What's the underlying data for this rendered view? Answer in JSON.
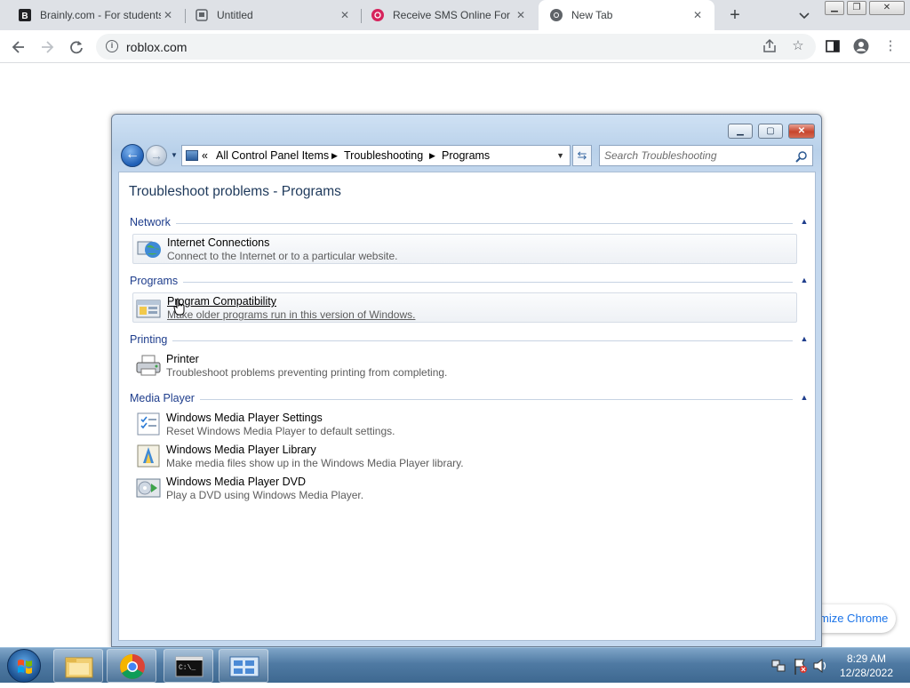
{
  "browser": {
    "tabs": [
      {
        "title": "Brainly.com - For students",
        "favicon": "brainly-icon",
        "active": false
      },
      {
        "title": "Untitled",
        "favicon": "document-icon",
        "active": false
      },
      {
        "title": "Receive SMS Online For",
        "favicon": "sms-icon",
        "active": false
      },
      {
        "title": "New Tab",
        "favicon": "chrome-icon",
        "active": true
      }
    ],
    "url": "roblox.com",
    "customize_chip": "mize Chrome"
  },
  "control_panel": {
    "breadcrumb": [
      "All Control Panel Items",
      "Troubleshooting",
      "Programs"
    ],
    "breadcrumb_overflow": "«",
    "search_placeholder": "Search Troubleshooting",
    "page_title": "Troubleshoot problems - Programs",
    "groups": [
      {
        "name": "Network",
        "items": [
          {
            "title": "Internet Connections",
            "desc": "Connect to the Internet or to a particular website.",
            "icon": "internet-connections-icon"
          }
        ]
      },
      {
        "name": "Programs",
        "items": [
          {
            "title": "Program Compatibility",
            "desc": "Make older programs run in this version of Windows.",
            "icon": "program-compatibility-icon"
          }
        ]
      },
      {
        "name": "Printing",
        "items": [
          {
            "title": "Printer",
            "desc": "Troubleshoot problems preventing printing from completing.",
            "icon": "printer-icon"
          }
        ]
      },
      {
        "name": "Media Player",
        "items": [
          {
            "title": "Windows Media Player Settings",
            "desc": "Reset Windows Media Player to default settings.",
            "icon": "wmp-settings-icon"
          },
          {
            "title": "Windows Media Player Library",
            "desc": "Make media files show up in the Windows Media Player library.",
            "icon": "wmp-library-icon"
          },
          {
            "title": "Windows Media Player DVD",
            "desc": "Play a DVD using Windows Media Player.",
            "icon": "wmp-dvd-icon"
          }
        ]
      }
    ]
  },
  "taskbar": {
    "time": "8:29 AM",
    "date": "12/28/2022"
  },
  "colors": {
    "chrome_tabstrip": "#dee1e6",
    "cp_link_blue": "#1e3d8c",
    "taskbar": "#4f7aa3"
  }
}
